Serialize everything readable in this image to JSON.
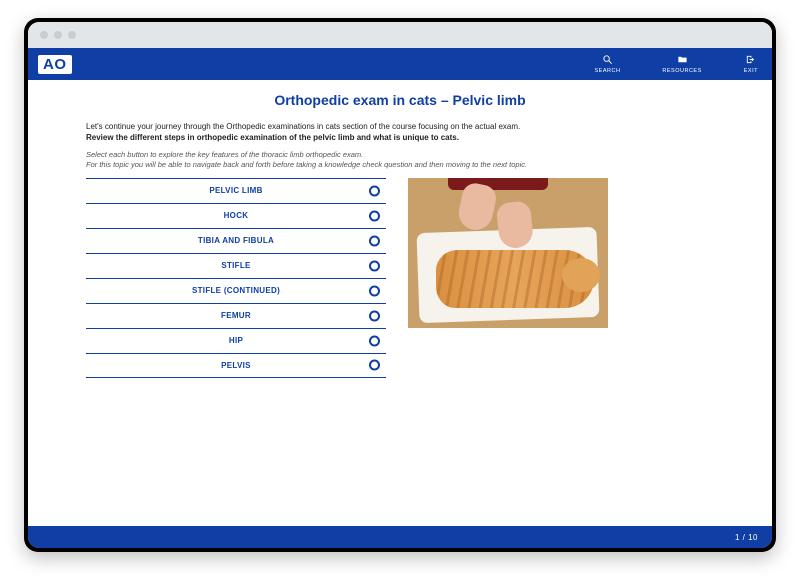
{
  "colors": {
    "brand_blue": "#0f3fa5"
  },
  "browser": {
    "dots": 3
  },
  "header": {
    "logo": "AO",
    "actions": {
      "search": "SEARCH",
      "resources": "RESOURCES",
      "exit": "EXIT"
    }
  },
  "page": {
    "title": "Orthopedic exam in cats – Pelvic limb",
    "intro_line1": "Let's continue your journey through the Orthopedic examinations in cats section of the course focusing on the actual exam.",
    "intro_bold": "Review the different steps in orthopedic examination of the pelvic limb and what is unique to cats.",
    "instruction_line1": "Select each button to explore the key features of the thoracic limb orthopedic exam.",
    "instruction_line2": "For this topic you will be able to navigate back and forth before taking a knowledge check question and then moving to the next topic."
  },
  "topics": [
    {
      "label": "PELVIC LIMB"
    },
    {
      "label": "HOCK"
    },
    {
      "label": "TIBIA AND FIBULA"
    },
    {
      "label": "STIFLE"
    },
    {
      "label": "STIFLE (CONTINUED)"
    },
    {
      "label": "FEMUR"
    },
    {
      "label": "HIP"
    },
    {
      "label": "PELVIS"
    }
  ],
  "image": {
    "alt": "Hands palpating an orange tabby cat lying on a towel"
  },
  "footer": {
    "page_indicator": "1 / 10"
  }
}
